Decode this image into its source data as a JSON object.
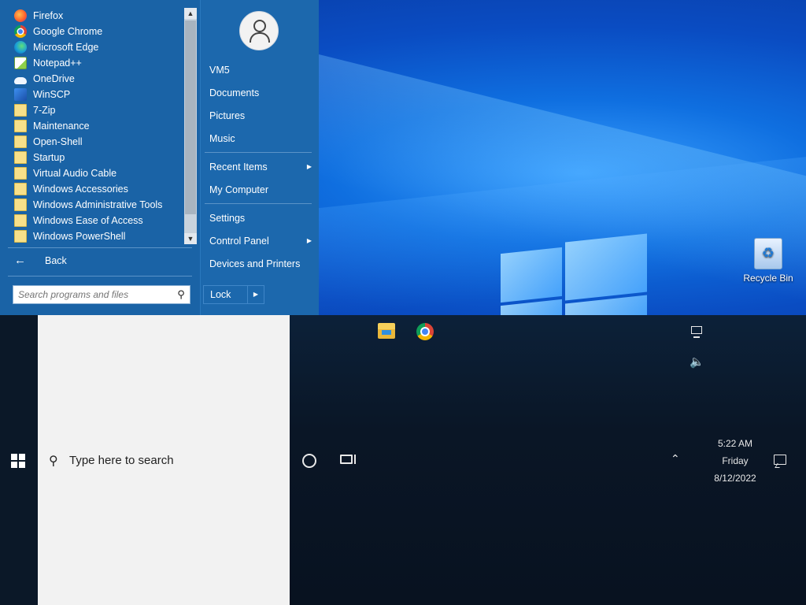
{
  "start_menu": {
    "programs": [
      {
        "label": "Firefox",
        "icon": "firefox-icon"
      },
      {
        "label": "Google Chrome",
        "icon": "chrome-icon"
      },
      {
        "label": "Microsoft Edge",
        "icon": "edge-icon"
      },
      {
        "label": "Notepad++",
        "icon": "notepad-plus-plus-icon"
      },
      {
        "label": "OneDrive",
        "icon": "onedrive-icon"
      },
      {
        "label": "WinSCP",
        "icon": "winscp-icon"
      },
      {
        "label": "7-Zip",
        "icon": "folder-icon"
      },
      {
        "label": "Maintenance",
        "icon": "folder-icon"
      },
      {
        "label": "Open-Shell",
        "icon": "folder-icon"
      },
      {
        "label": "Startup",
        "icon": "folder-icon"
      },
      {
        "label": "Virtual Audio Cable",
        "icon": "folder-icon"
      },
      {
        "label": "Windows Accessories",
        "icon": "folder-icon"
      },
      {
        "label": "Windows Administrative Tools",
        "icon": "folder-icon"
      },
      {
        "label": "Windows Ease of Access",
        "icon": "folder-icon"
      },
      {
        "label": "Windows PowerShell",
        "icon": "folder-icon"
      }
    ],
    "back_label": "Back",
    "search_placeholder": "Search programs and files",
    "right_items": {
      "user": "VM5",
      "documents": "Documents",
      "pictures": "Pictures",
      "music": "Music",
      "recent_items": "Recent Items",
      "my_computer": "My Computer",
      "settings": "Settings",
      "control_panel": "Control Panel",
      "devices_printers": "Devices and Printers"
    },
    "lock_label": "Lock",
    "colors": {
      "left_panel": "#1a63a6",
      "right_panel": "#1c68ad"
    }
  },
  "desktop": {
    "recycle_bin_label": "Recycle Bin"
  },
  "taskbar": {
    "search_placeholder": "Type here to search",
    "pinned": [
      "file-explorer-icon",
      "chrome-icon"
    ],
    "clock": {
      "time": "5:22 AM",
      "day": "Friday",
      "date": "8/12/2022"
    }
  }
}
